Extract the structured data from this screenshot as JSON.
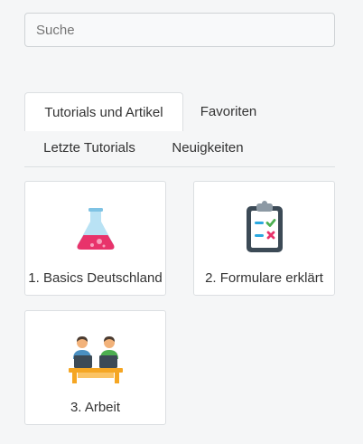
{
  "search": {
    "placeholder": "Suche",
    "value": ""
  },
  "tabs": [
    {
      "label": "Tutorials und Artikel",
      "active": true
    },
    {
      "label": "Favoriten",
      "active": false
    },
    {
      "label": "Letzte Tutorials",
      "active": false
    },
    {
      "label": "Neuigkeiten",
      "active": false
    }
  ],
  "cards": [
    {
      "label": "1. Basics Deutschland",
      "icon": "flask-icon"
    },
    {
      "label": "2. Formulare erklärt",
      "icon": "clipboard-checklist-icon"
    },
    {
      "label": "3. Arbeit",
      "icon": "people-at-desk-icon"
    }
  ],
  "colors": {
    "background": "#f5f6f7",
    "card_border": "#dcdfe2",
    "flask_liquid": "#e8336b",
    "flask_glass": "#9fd4ec",
    "check_green": "#4caf50",
    "cross_red": "#e8336b",
    "desk_orange": "#f5a623"
  }
}
